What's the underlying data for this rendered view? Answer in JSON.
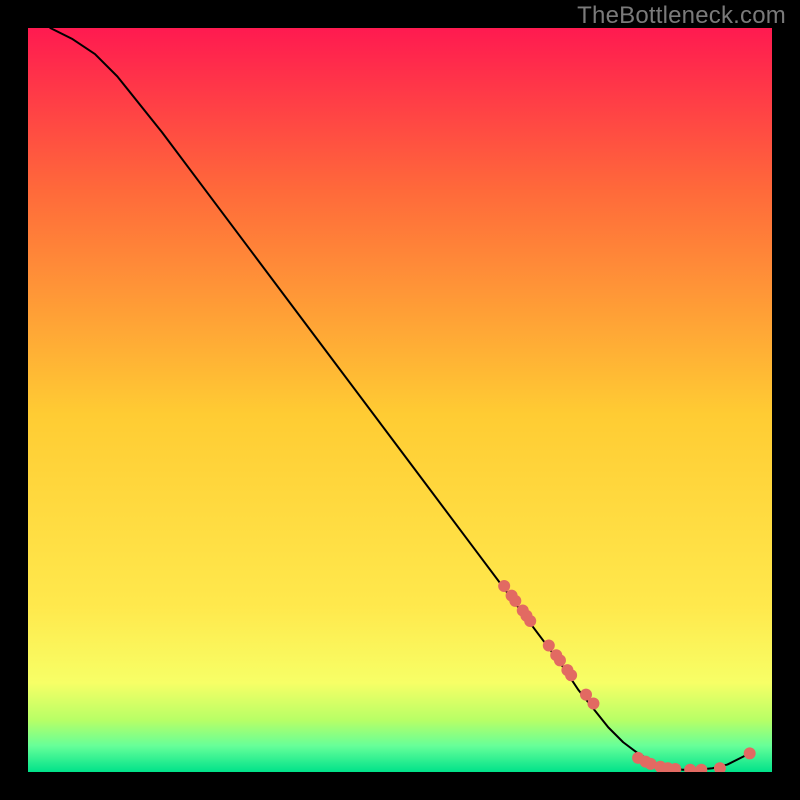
{
  "watermark": "TheBottleneck.com",
  "colors": {
    "bg": "#000000",
    "grad_top": "#ff1a50",
    "grad_mid_upper": "#ff6a3a",
    "grad_mid": "#ffcc33",
    "grad_mid_lower": "#ffe94d",
    "grad_band_yellow": "#f7ff66",
    "grad_band_green1": "#b8ff66",
    "grad_band_green2": "#66ff99",
    "grad_bottom": "#00e28a",
    "line": "#000000",
    "marker": "#e26a62"
  },
  "chart_data": {
    "type": "line",
    "title": "",
    "xlabel": "",
    "ylabel": "",
    "xlim": [
      0,
      100
    ],
    "ylim": [
      0,
      100
    ],
    "grid": false,
    "series": [
      {
        "name": "curve",
        "x": [
          3,
          6,
          9,
          12,
          18,
          24,
          30,
          36,
          42,
          48,
          54,
          60,
          66,
          69,
          72,
          74,
          76,
          78,
          80,
          82,
          84,
          86,
          88,
          90,
          92,
          94,
          97
        ],
        "y": [
          100,
          98.5,
          96.5,
          93.5,
          86,
          78,
          70,
          62,
          54,
          46,
          38,
          30,
          22,
          18,
          14,
          11,
          8.5,
          6,
          4,
          2.5,
          1.3,
          0.6,
          0.3,
          0.3,
          0.5,
          1.0,
          2.5
        ]
      }
    ],
    "markers": {
      "name": "points",
      "x": [
        64,
        65,
        65.5,
        66.5,
        67,
        67.5,
        70,
        71,
        71.5,
        72.5,
        73,
        75,
        76,
        82,
        83,
        83.7,
        85,
        86,
        87,
        89,
        90.5,
        93,
        97
      ],
      "y": [
        25,
        23.7,
        23,
        21.7,
        21,
        20.3,
        17,
        15.7,
        15,
        13.7,
        13,
        10.4,
        9.2,
        1.9,
        1.4,
        1.1,
        0.7,
        0.5,
        0.4,
        0.3,
        0.3,
        0.5,
        2.5
      ]
    }
  }
}
